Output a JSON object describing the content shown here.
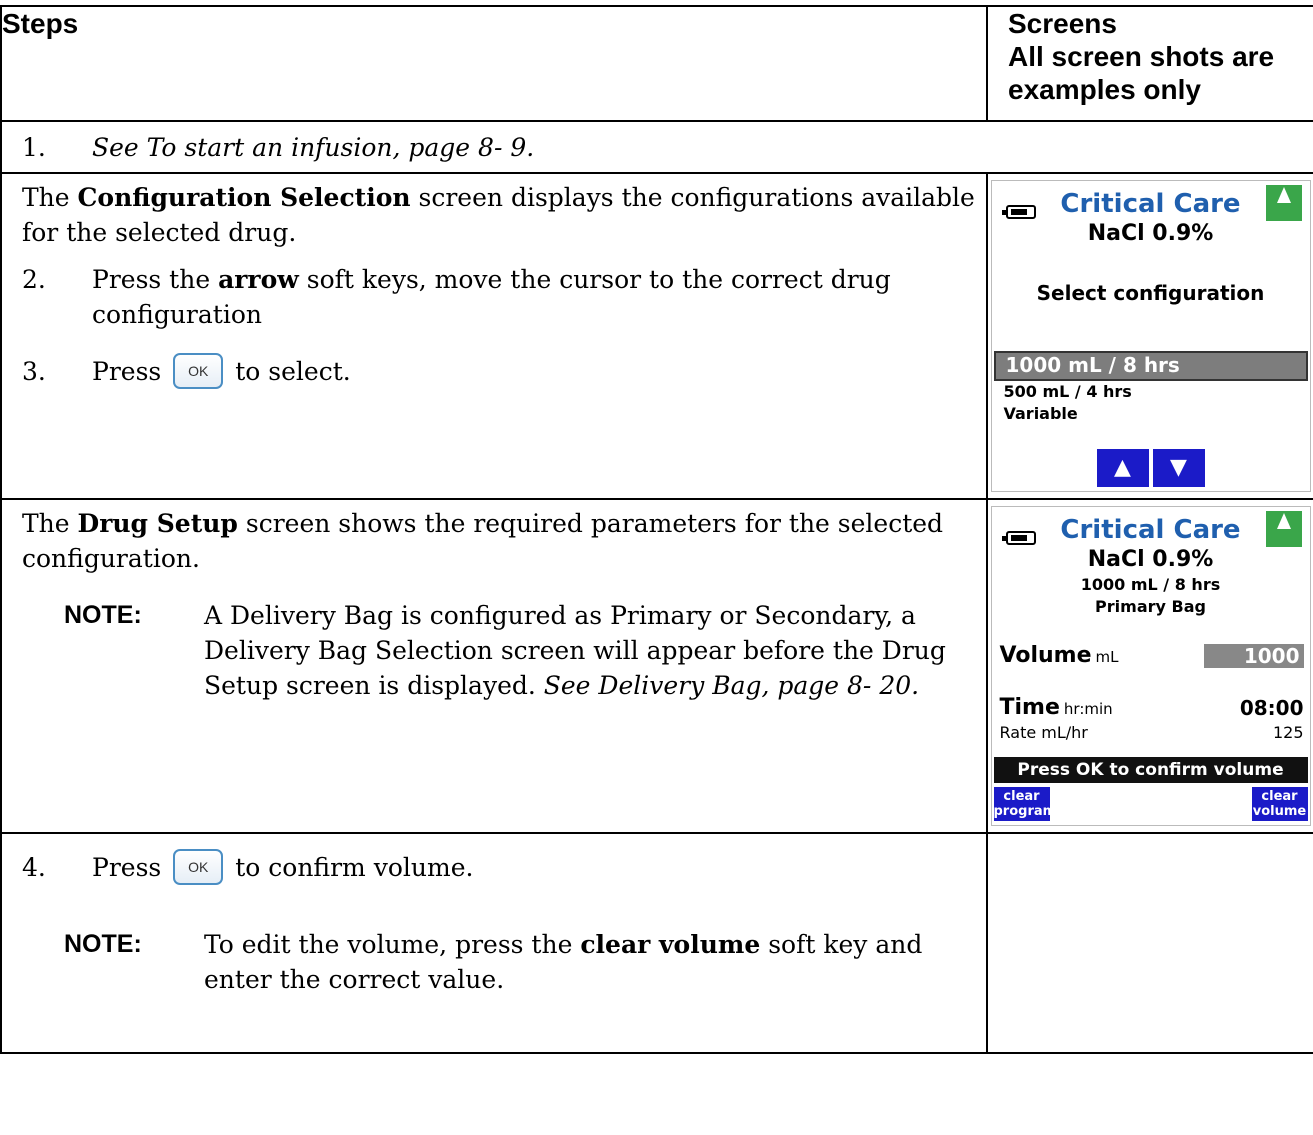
{
  "headers": {
    "steps": "Steps",
    "screens_line1": "Screens",
    "screens_line2": "All screen shots are",
    "screens_line3": "examples only"
  },
  "row1": {
    "num": "1.",
    "text": "See To start an infusion, page 8- 9."
  },
  "row2": {
    "p1_a": "The ",
    "p1_b": "Configuration Selection",
    "p1_c": " screen displays the configurations available for the selected drug.",
    "step2_num": "2.",
    "step2_a": "Press the ",
    "step2_b": "arrow",
    "step2_c": " soft keys, move the cursor to the correct drug configuration",
    "step3_num": "3.",
    "step3_a": "Press",
    "step3_c": "to select.",
    "ok_label": "OK"
  },
  "screen1": {
    "title": "Critical Care",
    "drug": "NaCl 0.9%",
    "heading": "Select configuration",
    "items": [
      "1000 mL / 8 hrs",
      "500 mL / 4 hrs",
      "Variable"
    ],
    "up": "▲",
    "down": "▼"
  },
  "row3": {
    "p1_a": "The ",
    "p1_b": "Drug Setup",
    "p1_c": " screen shows the required parameters for the selected configuration.",
    "note_label": "NOTE:",
    "note_text": "A Delivery Bag is configured as Primary or Secondary, a Delivery Bag Selection screen will appear before the Drug Setup screen is displayed. ",
    "note_italic": "See Delivery Bag, page 8- 20."
  },
  "screen2": {
    "title": "Critical Care",
    "drug": "NaCl 0.9%",
    "config": "1000 mL / 8 hrs",
    "bag": "Primary Bag",
    "volume_label": "Volume",
    "volume_unit": "mL",
    "volume_value": "1000",
    "time_label": "Time",
    "time_unit": "hr:min",
    "time_value": "08:00",
    "rate_label": "Rate mL/hr",
    "rate_value": "125",
    "message": "Press OK to confirm volume",
    "left_key_1": "clear",
    "left_key_2": "program",
    "right_key_1": "clear",
    "right_key_2": "volume"
  },
  "row4": {
    "num": "4.",
    "a": "Press",
    "c": "to confirm volume.",
    "ok_label": "OK",
    "note_label": "NOTE:",
    "note_a": "To edit the volume, press the ",
    "note_b": "clear volume",
    "note_c": " soft key and enter the correct value."
  }
}
